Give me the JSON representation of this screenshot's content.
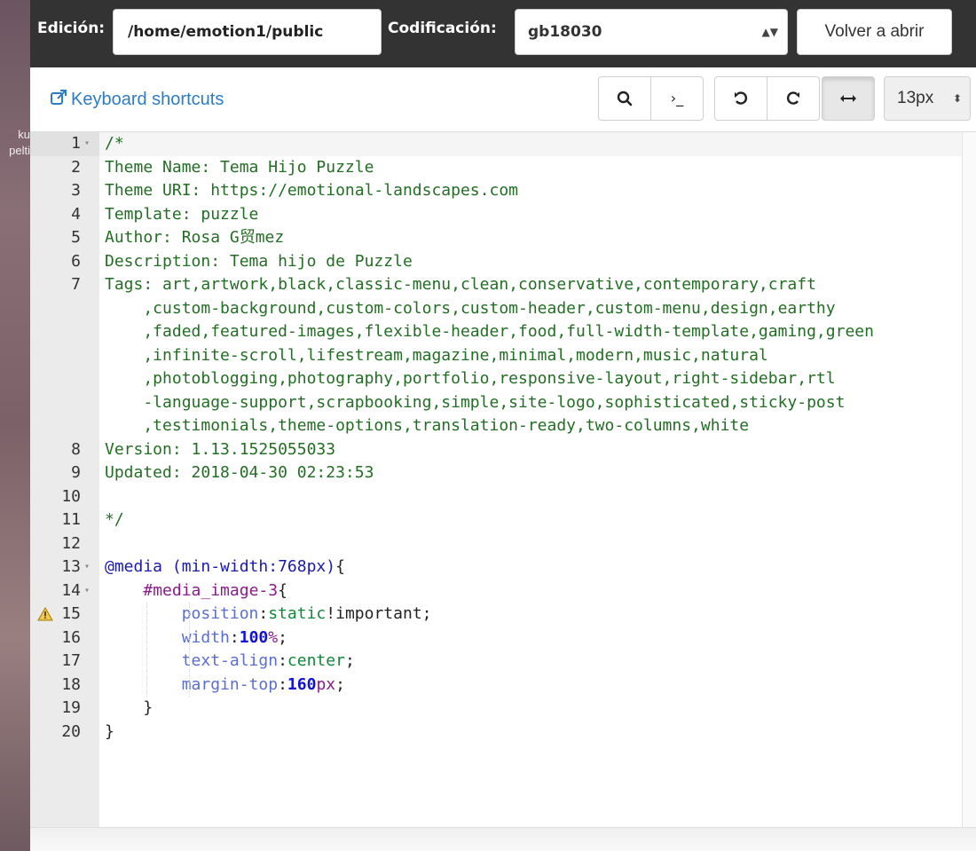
{
  "desktop": {
    "partial_labels": [
      "ku",
      "pelti"
    ]
  },
  "toolbar": {
    "edit_label": "Edición:",
    "path_value": "/home/emotion1/public",
    "encoding_label": "Codificación:",
    "encoding_value": "gb18030",
    "reopen_label": "Volver a abrir"
  },
  "subtoolbar": {
    "keyboard_shortcuts": "Keyboard shortcuts",
    "font_size": "13px",
    "buttons": [
      "search-icon",
      "terminal-icon",
      "undo-icon",
      "redo-icon",
      "wrap-icon"
    ],
    "wrap_active": true
  },
  "editor": {
    "lines": [
      {
        "num": "1",
        "fold": true,
        "text": "/*"
      },
      {
        "num": "2",
        "text": "Theme Name: Tema Hijo Puzzle"
      },
      {
        "num": "3",
        "text": "Theme URI: https://emotional-landscapes.com"
      },
      {
        "num": "4",
        "text": "Template: puzzle"
      },
      {
        "num": "5",
        "text": "Author: Rosa G贸mez"
      },
      {
        "num": "6",
        "text": "Description: Tema hijo de Puzzle"
      },
      {
        "num": "7",
        "text": "Tags: art,artwork,black,classic-menu,clean,conservative,contemporary,craft"
      },
      {
        "num": "",
        "text": "    ,custom-background,custom-colors,custom-header,custom-menu,design,earthy"
      },
      {
        "num": "",
        "text": "    ,faded,featured-images,flexible-header,food,full-width-template,gaming,green"
      },
      {
        "num": "",
        "text": "    ,infinite-scroll,lifestream,magazine,minimal,modern,music,natural"
      },
      {
        "num": "",
        "text": "    ,photoblogging,photography,portfolio,responsive-layout,right-sidebar,rtl"
      },
      {
        "num": "",
        "text": "    -language-support,scrapbooking,simple,site-logo,sophisticated,sticky-post"
      },
      {
        "num": "",
        "text": "    ,testimonials,theme-options,translation-ready,two-columns,white"
      },
      {
        "num": "8",
        "text": "Version: 1.13.1525055033"
      },
      {
        "num": "9",
        "text": "Updated: 2018-04-30 02:23:53"
      },
      {
        "num": "10",
        "text": ""
      },
      {
        "num": "11",
        "text": "*/"
      },
      {
        "num": "12",
        "text": ""
      },
      {
        "num": "13",
        "fold": true,
        "text": "@media (min-width:768px){"
      },
      {
        "num": "14",
        "fold": true,
        "text": "    #media_image-3{"
      },
      {
        "num": "15",
        "warn": true,
        "text": "        position:static!important;"
      },
      {
        "num": "16",
        "text": "        width:100%;"
      },
      {
        "num": "17",
        "text": "        text-align:center;"
      },
      {
        "num": "18",
        "text": "        margin-top:160px;"
      },
      {
        "num": "19",
        "text": "    }"
      },
      {
        "num": "20",
        "text": "}"
      }
    ]
  }
}
